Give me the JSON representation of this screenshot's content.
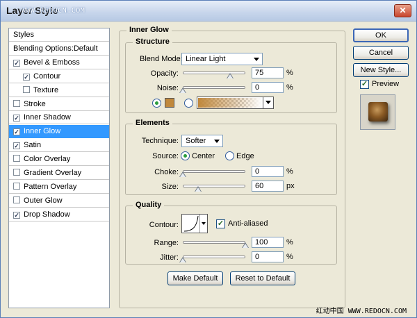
{
  "window": {
    "title": "Layer Style",
    "watermark": "WWW.REDOCN.COM",
    "close_glyph": "✕"
  },
  "styles_list": {
    "items": [
      {
        "label": "Styles",
        "checkbox": false,
        "checked": false,
        "selected": false,
        "indent": 0
      },
      {
        "label": "Blending Options:Default",
        "checkbox": false,
        "checked": false,
        "selected": false,
        "indent": 0
      },
      {
        "label": "Bevel & Emboss",
        "checkbox": true,
        "checked": true,
        "selected": false,
        "indent": 0
      },
      {
        "label": "Contour",
        "checkbox": true,
        "checked": true,
        "selected": false,
        "indent": 1
      },
      {
        "label": "Texture",
        "checkbox": true,
        "checked": false,
        "selected": false,
        "indent": 1
      },
      {
        "label": "Stroke",
        "checkbox": true,
        "checked": false,
        "selected": false,
        "indent": 0
      },
      {
        "label": "Inner Shadow",
        "checkbox": true,
        "checked": true,
        "selected": false,
        "indent": 0
      },
      {
        "label": "Inner Glow",
        "checkbox": true,
        "checked": true,
        "selected": true,
        "indent": 0
      },
      {
        "label": "Satin",
        "checkbox": true,
        "checked": true,
        "selected": false,
        "indent": 0
      },
      {
        "label": "Color Overlay",
        "checkbox": true,
        "checked": false,
        "selected": false,
        "indent": 0
      },
      {
        "label": "Gradient Overlay",
        "checkbox": true,
        "checked": false,
        "selected": false,
        "indent": 0
      },
      {
        "label": "Pattern Overlay",
        "checkbox": true,
        "checked": false,
        "selected": false,
        "indent": 0
      },
      {
        "label": "Outer Glow",
        "checkbox": true,
        "checked": false,
        "selected": false,
        "indent": 0
      },
      {
        "label": "Drop Shadow",
        "checkbox": true,
        "checked": true,
        "selected": false,
        "indent": 0
      }
    ]
  },
  "inner_glow": {
    "title": "Inner Glow",
    "structure": {
      "title": "Structure",
      "blend_mode_label": "Blend Mode:",
      "blend_mode_value": "Linear Light",
      "opacity_label": "Opacity:",
      "opacity_value": "75",
      "opacity_fraction": 0.75,
      "noise_label": "Noise:",
      "noise_value": "0",
      "noise_fraction": 0,
      "percent": "%",
      "glow_color": "#c0883c",
      "gradient_colors": [
        "#c0883c",
        "#ffffff"
      ]
    },
    "elements": {
      "title": "Elements",
      "technique_label": "Technique:",
      "technique_value": "Softer",
      "source_label": "Source:",
      "source_center": "Center",
      "source_edge": "Edge",
      "choke_label": "Choke:",
      "choke_value": "0",
      "choke_fraction": 0,
      "size_label": "Size:",
      "size_value": "60",
      "size_fraction": 0.24,
      "percent": "%",
      "px": "px"
    },
    "quality": {
      "title": "Quality",
      "contour_label": "Contour:",
      "anti_aliased_label": "Anti-aliased",
      "range_label": "Range:",
      "range_value": "100",
      "range_fraction": 1,
      "jitter_label": "Jitter:",
      "jitter_value": "0",
      "jitter_fraction": 0,
      "percent": "%"
    },
    "make_default_label": "Make Default",
    "reset_default_label": "Reset to Default"
  },
  "right_panel": {
    "ok_label": "OK",
    "cancel_label": "Cancel",
    "new_style_label": "New Style...",
    "preview_label": "Preview"
  },
  "footer_watermark": "红动中国 WWW.REDOCN.COM"
}
